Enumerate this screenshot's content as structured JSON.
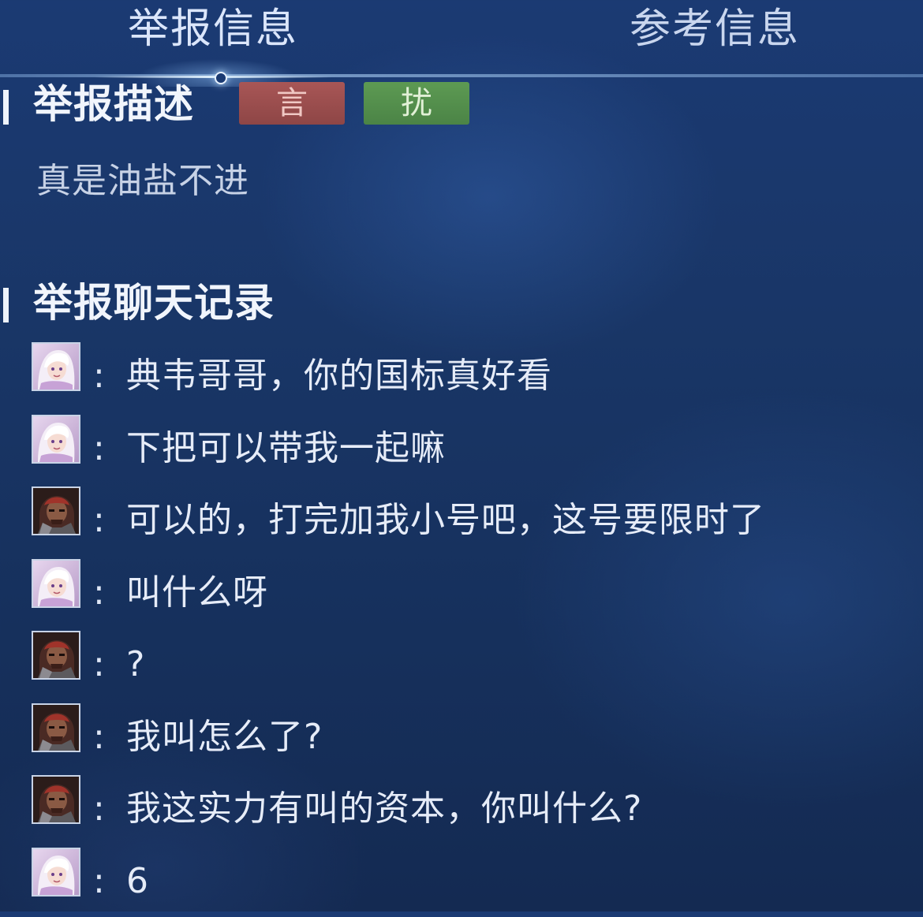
{
  "tabs": [
    {
      "label": "举报信息",
      "active": true
    },
    {
      "label": "参考信息",
      "active": false
    }
  ],
  "description_section": {
    "title": "举报描述",
    "tags": [
      {
        "label": "言",
        "color": "#9c4f4f"
      },
      {
        "label": "扰",
        "color": "#568f4d"
      }
    ],
    "text": "真是油盐不进"
  },
  "chat_section": {
    "title": "举报聊天记录",
    "messages": [
      {
        "avatar": "female-hero-avatar-icon",
        "separator": ":",
        "text": "典韦哥哥，你的国标真好看"
      },
      {
        "avatar": "female-hero-avatar-icon",
        "separator": ":",
        "text": "下把可以带我一起嘛"
      },
      {
        "avatar": "male-hero-avatar-icon",
        "separator": ":",
        "text": "可以的，打完加我小号吧，这号要限时了"
      },
      {
        "avatar": "female-hero-avatar-icon",
        "separator": ":",
        "text": "叫什么呀"
      },
      {
        "avatar": "male-hero-avatar-icon",
        "separator": ":",
        "text": "?"
      },
      {
        "avatar": "male-hero-avatar-icon",
        "separator": ":",
        "text": "我叫怎么了?"
      },
      {
        "avatar": "male-hero-avatar-icon",
        "separator": ":",
        "text": "我这实力有叫的资本，你叫什么?"
      },
      {
        "avatar": "female-hero-avatar-icon",
        "separator": ":",
        "text": "6"
      }
    ]
  },
  "colors": {
    "background": "#183464",
    "text": "#e6ecf8",
    "tag_red": "#9c4f4f",
    "tag_green": "#568f4d"
  }
}
